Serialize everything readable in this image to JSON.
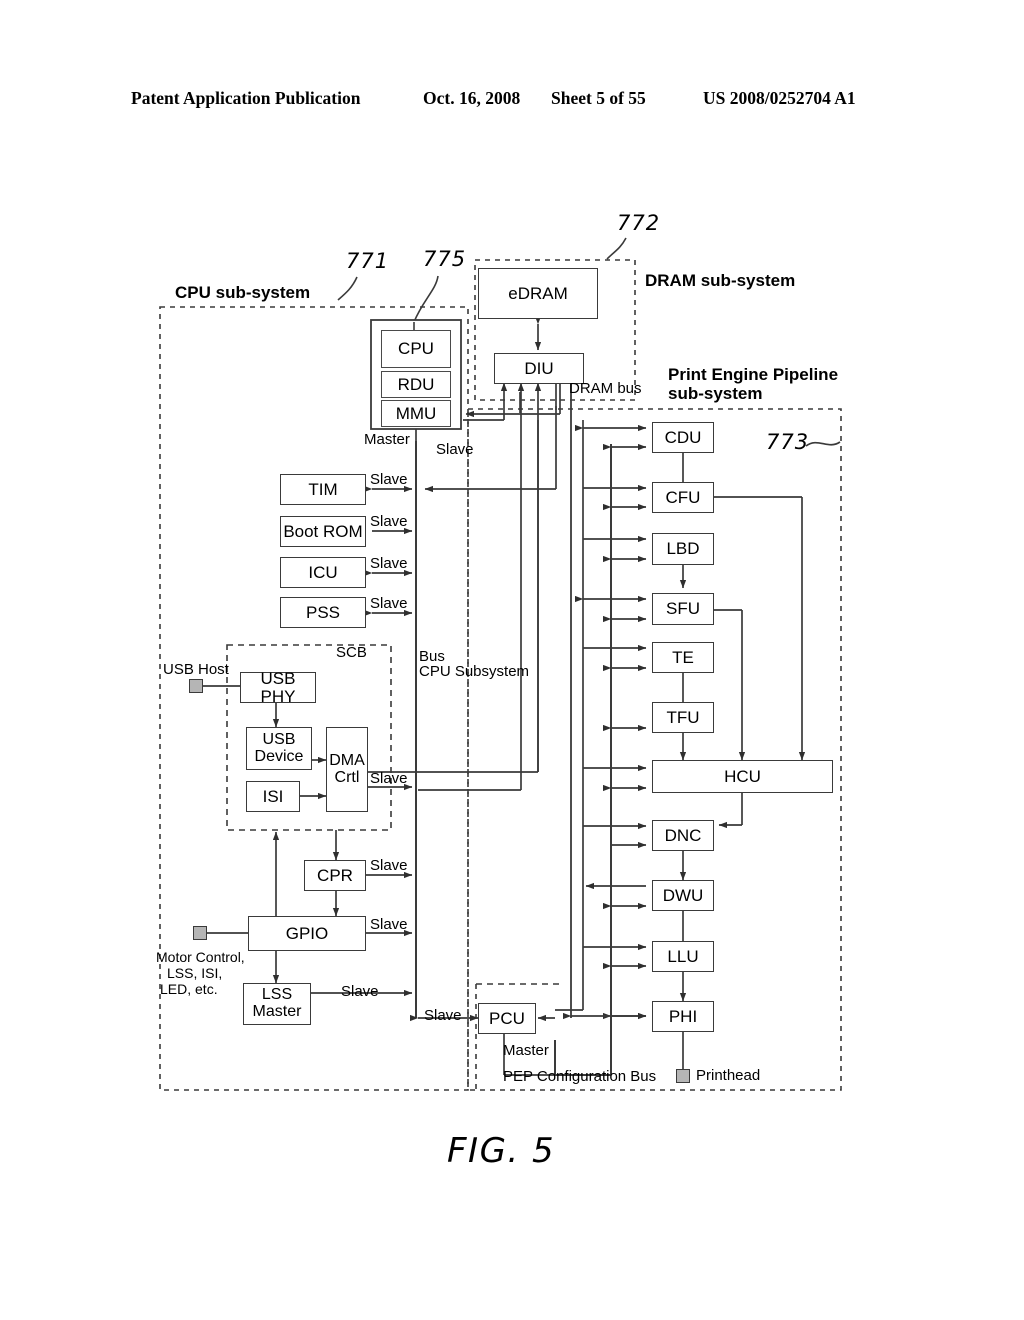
{
  "header": {
    "publication": "Patent Application Publication",
    "date": "Oct. 16, 2008",
    "sheet": "Sheet 5 of 55",
    "number": "US 2008/0252704 A1"
  },
  "figure": {
    "caption": "FIG. 5"
  },
  "subsystems": {
    "cpu": {
      "title": "CPU sub-system",
      "ref": "771"
    },
    "dram": {
      "title": "DRAM sub-system",
      "ref": "772"
    },
    "pep": {
      "title_line1": "Print Engine Pipeline",
      "title_line2": "sub-system",
      "ref": "773"
    },
    "cpu_core_ref": "775",
    "scb": {
      "title": "SCB"
    }
  },
  "blocks": {
    "cpu": "CPU",
    "rdu": "RDU",
    "mmu": "MMU",
    "edram": "eDRAM",
    "diu": "DIU",
    "tim": "TIM",
    "boot_rom": "Boot ROM",
    "icu": "ICU",
    "pss": "PSS",
    "usb_phy": "USB PHY",
    "usb_device_l1": "USB",
    "usb_device_l2": "Device",
    "isi": "ISI",
    "dma_l1": "DMA",
    "dma_l2": "Crtl",
    "cpr": "CPR",
    "gpio": "GPIO",
    "lss_l1": "LSS",
    "lss_l2": "Master",
    "pcu": "PCU",
    "cdu": "CDU",
    "cfu": "CFU",
    "lbd": "LBD",
    "sfu": "SFU",
    "te": "TE",
    "tfu": "TFU",
    "hcu": "HCU",
    "dnc": "DNC",
    "dwu": "DWU",
    "llu": "LLU",
    "phi": "PHI"
  },
  "labels": {
    "master_cpu": "Master",
    "slave_cpu_bus": "Slave",
    "slave_tim": "Slave",
    "slave_bootrom": "Slave",
    "slave_icu": "Slave",
    "slave_pss": "Slave",
    "slave_dma": "Slave",
    "slave_cpr": "Slave",
    "slave_gpio": "Slave",
    "slave_lss": "Slave",
    "slave_pcu": "Slave",
    "master_pcu": "Master",
    "dram_bus": "DRAM bus",
    "bus_l1": "Bus",
    "bus_l2": "CPU Subsystem",
    "usb_host": "USB Host",
    "motor_l1": "Motor Control,",
    "motor_l2": "LSS, ISI,",
    "motor_l3": "LED, etc.",
    "pep_config_bus": "PEP Configuration Bus",
    "printhead": "Printhead"
  },
  "connectors": {
    "usb_host": "usb-host-connector",
    "motor": "motor-control-connector",
    "printhead": "printhead-connector"
  },
  "colors": {
    "line": "#3a3a3a",
    "connector_fill": "#b5b5b5",
    "background": "#ffffff"
  }
}
